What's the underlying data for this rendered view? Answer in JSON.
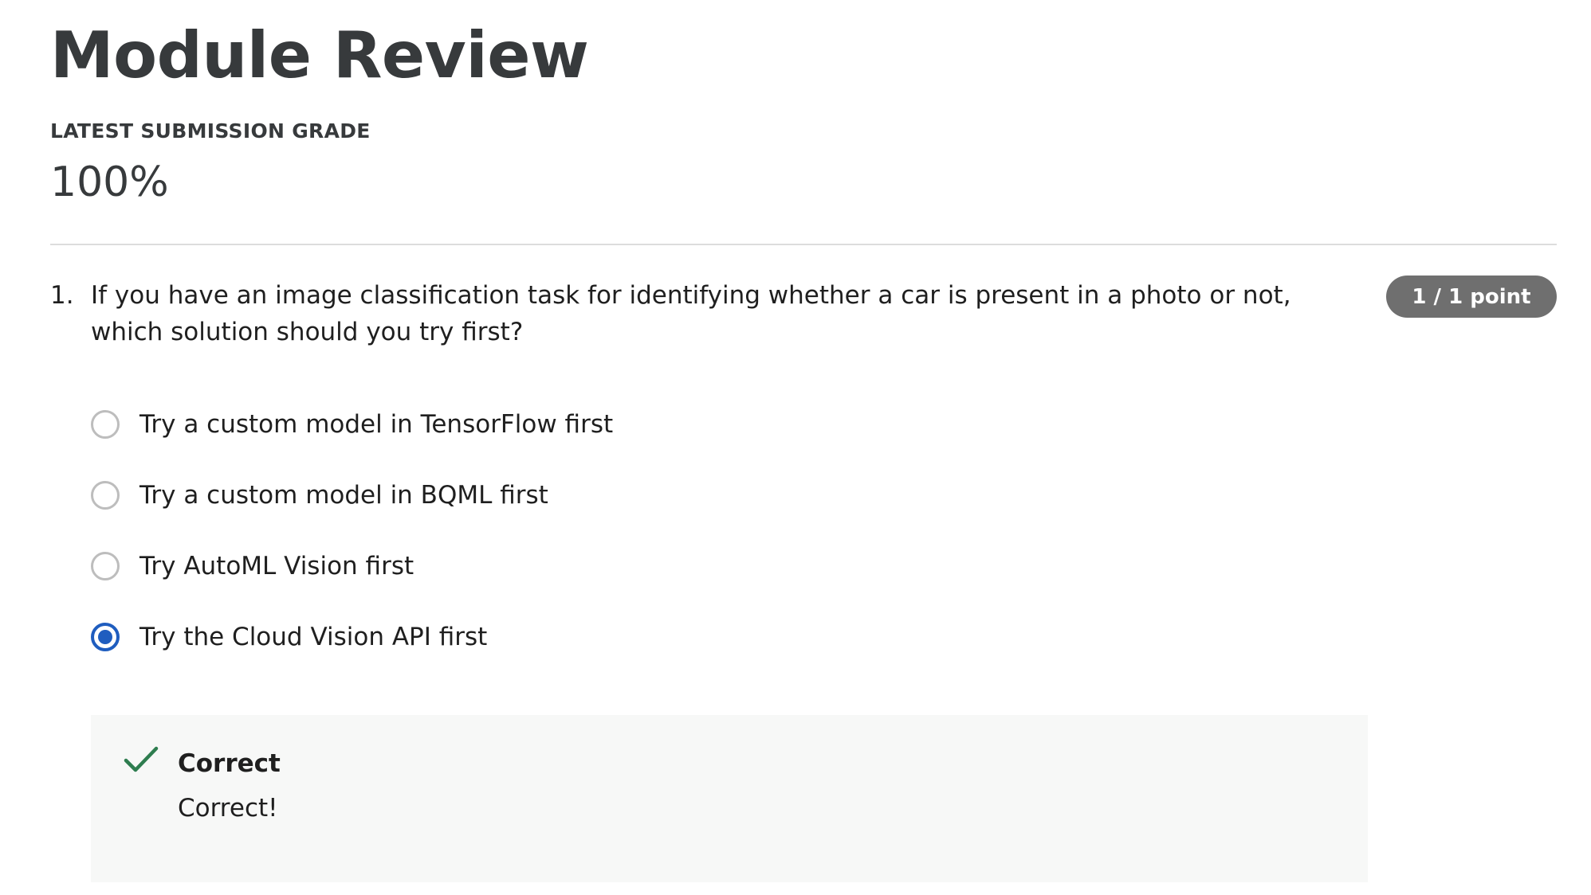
{
  "page": {
    "title": "Module Review"
  },
  "grade": {
    "label": "LATEST SUBMISSION GRADE",
    "value": "100%"
  },
  "question": {
    "number": "1.",
    "text": "If you have an image classification task for identifying whether a car is present in a photo or not, which solution should you try first?",
    "points": "1 / 1 point",
    "options": [
      {
        "label": "Try a custom model in TensorFlow first",
        "selected": false
      },
      {
        "label": "Try a custom model in BQML first",
        "selected": false
      },
      {
        "label": "Try AutoML Vision first",
        "selected": false
      },
      {
        "label": "Try the Cloud Vision API first",
        "selected": true
      }
    ],
    "feedback": {
      "icon": "checkmark-icon",
      "title": "Correct",
      "text": "Correct!",
      "color": "#2e7d4f"
    }
  },
  "colors": {
    "accent": "#1f5dbf",
    "badge": "#6f6f6f",
    "feedback_bg": "#f7f8f7",
    "divider": "#dcdcdc"
  }
}
